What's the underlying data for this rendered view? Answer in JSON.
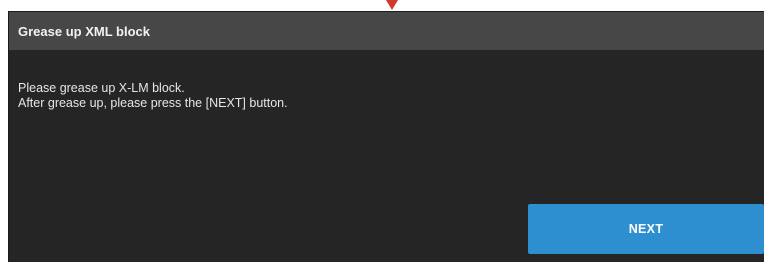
{
  "dialog": {
    "title": "Grease up XML block",
    "message_lines": [
      "Please grease up X-LM block.",
      "After grease up, please press the [NEXT] button."
    ],
    "next_label": "NEXT"
  },
  "colors": {
    "title_bar": "#474747",
    "dialog_background": "#252525",
    "button_accent": "#2d8fd0",
    "marker": "#d0392b"
  }
}
